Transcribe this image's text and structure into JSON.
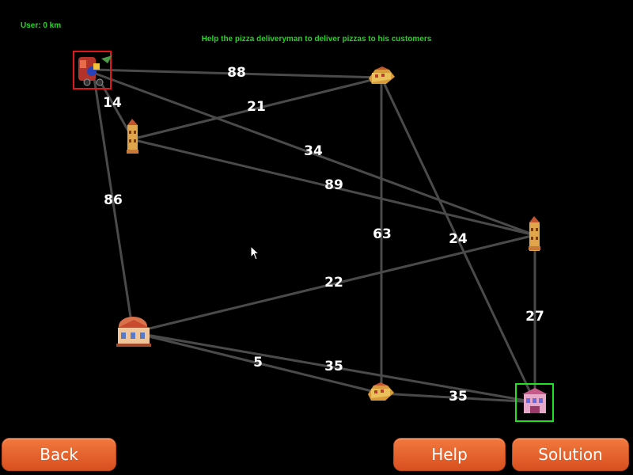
{
  "hud": {
    "user_distance": "User: 0 km",
    "instruction": "Help the pizza deliveryman to deliver pizzas to his customers"
  },
  "graph": {
    "weights": [
      "88",
      "14",
      "21",
      "34",
      "89",
      "86",
      "63",
      "24",
      "27",
      "22",
      "5",
      "35",
      "35"
    ]
  },
  "buttons": {
    "back": "Back",
    "help": "Help",
    "solution": "Solution"
  },
  "colors": {
    "hud_text": "#22d622",
    "start_marker": "#e01818",
    "goal_marker": "#22e022",
    "button": "#e8602c"
  }
}
